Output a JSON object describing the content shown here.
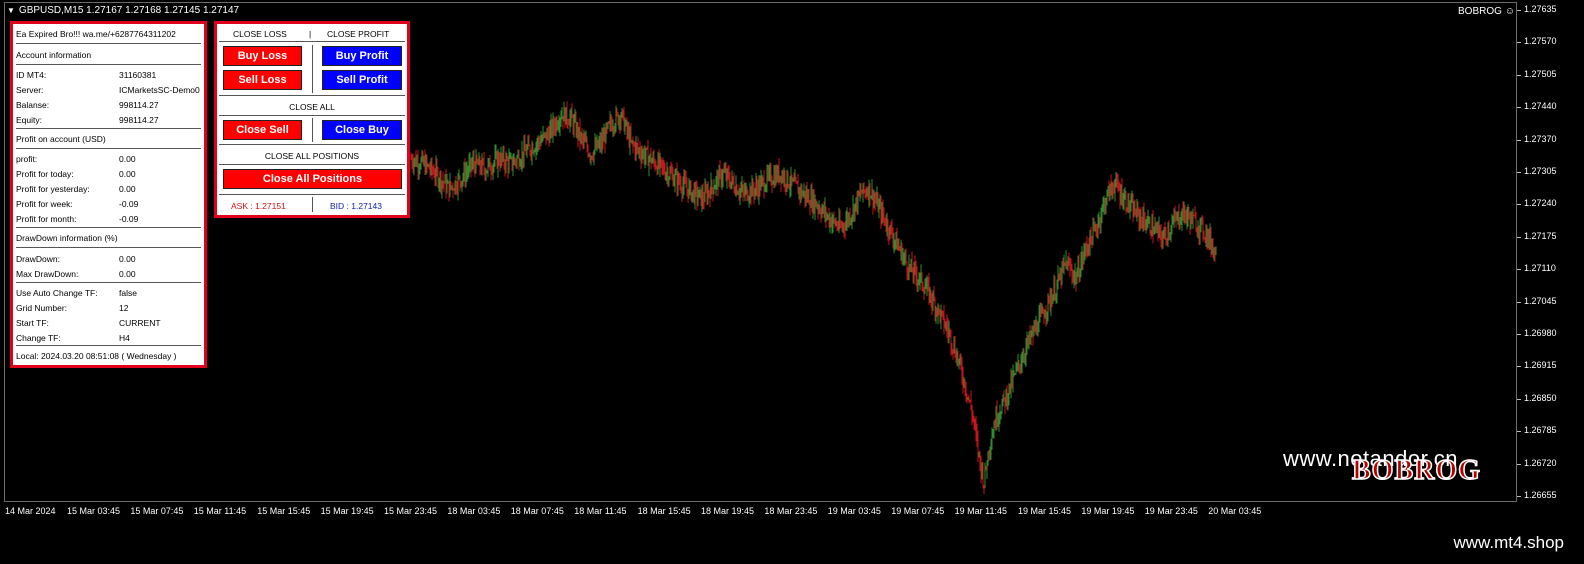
{
  "chart": {
    "symbol_line": "GBPUSD,M15  1.27167 1.27168 1.27145 1.27147",
    "brand": "BOBROG",
    "price_ticks": [
      "1.27635",
      "1.27570",
      "1.27505",
      "1.27440",
      "1.27370",
      "1.27305",
      "1.27240",
      "1.27175",
      "1.27110",
      "1.27045",
      "1.26980",
      "1.26915",
      "1.26850",
      "1.26785",
      "1.26720",
      "1.26655"
    ],
    "time_ticks": [
      "14 Mar 2024",
      "15 Mar 03:45",
      "15 Mar 07:45",
      "15 Mar 11:45",
      "15 Mar 15:45",
      "15 Mar 19:45",
      "15 Mar 23:45",
      "18 Mar 03:45",
      "18 Mar 07:45",
      "18 Mar 11:45",
      "18 Mar 15:45",
      "18 Mar 19:45",
      "18 Mar 23:45",
      "19 Mar 03:45",
      "19 Mar 07:45",
      "19 Mar 11:45",
      "19 Mar 15:45",
      "19 Mar 19:45",
      "19 Mar 23:45",
      "20 Mar 03:45"
    ],
    "colors": {
      "bull": "#2e8b2e",
      "bear": "#c8141e",
      "background": "#000000"
    },
    "price_path": [
      [
        0,
        1.2734
      ],
      [
        12,
        1.2733
      ],
      [
        25,
        1.2731
      ],
      [
        38,
        1.2728
      ],
      [
        50,
        1.273
      ],
      [
        62,
        1.2733
      ],
      [
        75,
        1.2732
      ],
      [
        88,
        1.2734
      ],
      [
        100,
        1.2733
      ],
      [
        112,
        1.2735
      ],
      [
        125,
        1.2737
      ],
      [
        138,
        1.2739
      ],
      [
        150,
        1.2743
      ],
      [
        160,
        1.2742
      ],
      [
        170,
        1.2738
      ],
      [
        180,
        1.2735
      ],
      [
        190,
        1.2737
      ],
      [
        200,
        1.2741
      ],
      [
        210,
        1.2743
      ],
      [
        220,
        1.2737
      ],
      [
        232,
        1.2735
      ],
      [
        245,
        1.2733
      ],
      [
        258,
        1.2731
      ],
      [
        270,
        1.2729
      ],
      [
        282,
        1.2727
      ],
      [
        292,
        1.2726
      ],
      [
        300,
        1.2728
      ],
      [
        312,
        1.2731
      ],
      [
        322,
        1.2729
      ],
      [
        332,
        1.2727
      ],
      [
        345,
        1.2728
      ],
      [
        358,
        1.273
      ],
      [
        370,
        1.2731
      ],
      [
        380,
        1.2729
      ],
      [
        392,
        1.2727
      ],
      [
        405,
        1.2725
      ],
      [
        418,
        1.2722
      ],
      [
        430,
        1.272
      ],
      [
        440,
        1.2723
      ],
      [
        450,
        1.2727
      ],
      [
        458,
        1.2728
      ],
      [
        468,
        1.2724
      ],
      [
        478,
        1.272
      ],
      [
        488,
        1.2716
      ],
      [
        498,
        1.2712
      ],
      [
        508,
        1.271
      ],
      [
        518,
        1.2707
      ],
      [
        528,
        1.2703
      ],
      [
        538,
        1.2699
      ],
      [
        548,
        1.2693
      ],
      [
        556,
        1.2687
      ],
      [
        562,
        1.2682
      ],
      [
        568,
        1.2674
      ],
      [
        573,
        1.2669
      ],
      [
        578,
        1.2676
      ],
      [
        585,
        1.2682
      ],
      [
        595,
        1.2686
      ],
      [
        605,
        1.2691
      ],
      [
        615,
        1.2696
      ],
      [
        625,
        1.27
      ],
      [
        635,
        1.2704
      ],
      [
        645,
        1.2708
      ],
      [
        655,
        1.2713
      ],
      [
        665,
        1.271
      ],
      [
        675,
        1.2716
      ],
      [
        685,
        1.272
      ],
      [
        695,
        1.2726
      ],
      [
        703,
        1.2729
      ],
      [
        710,
        1.2727
      ],
      [
        720,
        1.2724
      ],
      [
        730,
        1.2722
      ],
      [
        742,
        1.272
      ],
      [
        752,
        1.2718
      ],
      [
        762,
        1.2721
      ],
      [
        772,
        1.2723
      ],
      [
        785,
        1.2721
      ],
      [
        795,
        1.2719
      ],
      [
        805,
        1.2715
      ]
    ]
  },
  "info_panel": {
    "expired_note": "Ea Expired Bro!!! wa.me/+6287764311202",
    "account_header": "Account information",
    "rows_account": [
      {
        "label": "ID MT4:",
        "value": "31160381"
      },
      {
        "label": "Server:",
        "value": "ICMarketsSC-Demo0"
      },
      {
        "label": "Balanse:",
        "value": "998114.27"
      },
      {
        "label": "Equity:",
        "value": "998114.27"
      }
    ],
    "profit_header": "Profit on account (USD)",
    "rows_profit": [
      {
        "label": "profit:",
        "value": "0.00"
      },
      {
        "label": "Profit for today:",
        "value": "0.00"
      },
      {
        "label": "Profit for yesterday:",
        "value": "0.00"
      },
      {
        "label": "Profit for week:",
        "value": "-0.09"
      },
      {
        "label": "Profit for month:",
        "value": "-0.09"
      }
    ],
    "drawdown_header": "DrawDown information (%)",
    "rows_drawdown": [
      {
        "label": "DrawDown:",
        "value": "0.00"
      },
      {
        "label": "Max DrawDown:",
        "value": "0.00"
      }
    ],
    "rows_settings": [
      {
        "label": "Use Auto Change TF:",
        "value": "false"
      },
      {
        "label": "Grid Number:",
        "value": "12"
      },
      {
        "label": "Start TF:",
        "value": "CURRENT"
      },
      {
        "label": "Change TF:",
        "value": "H4"
      }
    ],
    "local_time": "Local: 2024.03.20 08:51:08 ( Wednesday )"
  },
  "trade_panel": {
    "close_loss_header": "CLOSE LOSS",
    "divider": "|",
    "close_profit_header": "CLOSE PROFIT",
    "buy_loss": "Buy Loss",
    "buy_profit": "Buy Profit",
    "sell_loss": "Sell Loss",
    "sell_profit": "Sell Profit",
    "close_all_header": "CLOSE ALL",
    "close_sell": "Close Sell",
    "close_buy": "Close Buy",
    "close_all_positions_header": "CLOSE ALL POSITIONS",
    "close_all_positions_button": "Close All Positions",
    "ask": "ASK : 1.27151",
    "bid": "BID : 1.27143",
    "ask_color": "#d01010",
    "bid_color": "#1020b0"
  },
  "watermark": {
    "site": "www.notandor.cn",
    "logo": "BOBROG"
  },
  "footer": {
    "site": "www.mt4.shop"
  }
}
